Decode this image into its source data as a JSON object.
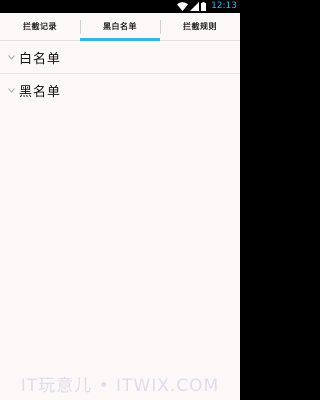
{
  "status_bar": {
    "time": "12:13",
    "icons": [
      "wifi-icon",
      "signal-icon",
      "battery-icon"
    ],
    "accent_color": "#33b5e5"
  },
  "tabs": [
    {
      "label": "拦截记录",
      "active": false
    },
    {
      "label": "黑白名单",
      "active": true
    },
    {
      "label": "拦截规则",
      "active": false
    }
  ],
  "groups": [
    {
      "label": "白名单",
      "expanded": false
    },
    {
      "label": "黑名单",
      "expanded": false
    }
  ],
  "watermark": "IT玩意儿 • ITWIX.COM",
  "colors": {
    "tab_indicator": "#33b5e5",
    "background": "#fdf8f8",
    "status_bar": "#000000"
  }
}
